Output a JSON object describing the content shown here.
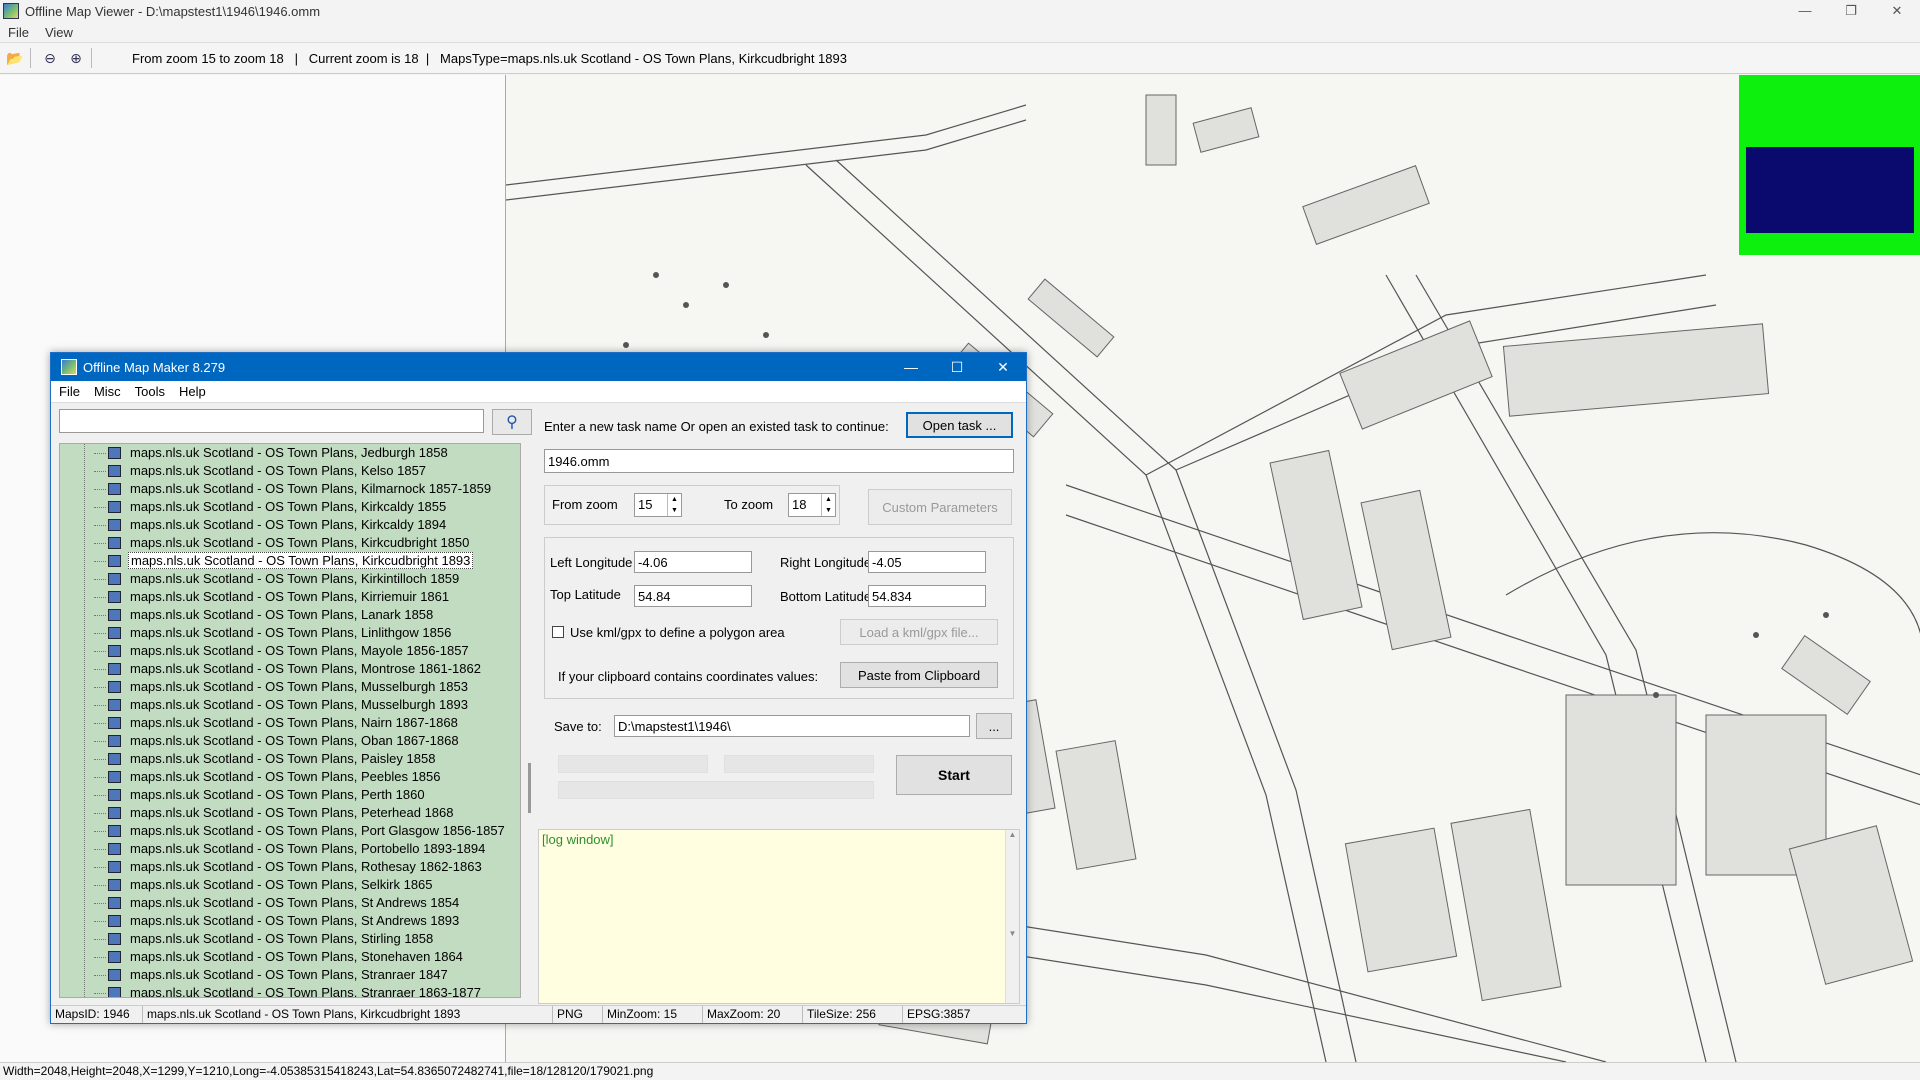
{
  "viewer": {
    "title": "Offline Map Viewer - D:\\mapstest1\\1946\\1946.omm",
    "menu": [
      "File",
      "View"
    ],
    "toolbar_info": "From zoom 15 to zoom 18   |   Current zoom is 18  |   MapsType=maps.nls.uk Scotland - OS Town Plans, Kirkcudbright 1893",
    "status": "Width=2048,Height=2048,X=1299,Y=1210,Long=-4.05385315418243,Lat=54.8365072482741,file=18/128120/179021.png",
    "icons": [
      "folder-open-icon",
      "zoom-out-icon",
      "zoom-in-icon"
    ]
  },
  "omm": {
    "title": "Offline Map Maker 8.279",
    "menu": [
      "File",
      "Misc",
      "Tools",
      "Help"
    ],
    "search_value": "",
    "tree_items": [
      "maps.nls.uk Scotland - OS Town Plans, Jedburgh 1858",
      "maps.nls.uk Scotland - OS Town Plans, Kelso 1857",
      "maps.nls.uk Scotland - OS Town Plans, Kilmarnock 1857-1859",
      "maps.nls.uk Scotland - OS Town Plans, Kirkcaldy 1855",
      "maps.nls.uk Scotland - OS Town Plans, Kirkcaldy 1894",
      "maps.nls.uk Scotland - OS Town Plans, Kirkcudbright 1850",
      "maps.nls.uk Scotland - OS Town Plans, Kirkcudbright 1893",
      "maps.nls.uk Scotland - OS Town Plans, Kirkintilloch 1859",
      "maps.nls.uk Scotland - OS Town Plans, Kirriemuir 1861",
      "maps.nls.uk Scotland - OS Town Plans, Lanark 1858",
      "maps.nls.uk Scotland - OS Town Plans, Linlithgow 1856",
      "maps.nls.uk Scotland - OS Town Plans, Mayole 1856-1857",
      "maps.nls.uk Scotland - OS Town Plans, Montrose 1861-1862",
      "maps.nls.uk Scotland - OS Town Plans, Musselburgh 1853",
      "maps.nls.uk Scotland - OS Town Plans, Musselburgh 1893",
      "maps.nls.uk Scotland - OS Town Plans, Nairn 1867-1868",
      "maps.nls.uk Scotland - OS Town Plans, Oban 1867-1868",
      "maps.nls.uk Scotland - OS Town Plans, Paisley 1858",
      "maps.nls.uk Scotland - OS Town Plans, Peebles 1856",
      "maps.nls.uk Scotland - OS Town Plans, Perth 1860",
      "maps.nls.uk Scotland - OS Town Plans, Peterhead 1868",
      "maps.nls.uk Scotland - OS Town Plans, Port Glasgow 1856-1857",
      "maps.nls.uk Scotland - OS Town Plans, Portobello 1893-1894",
      "maps.nls.uk Scotland - OS Town Plans, Rothesay 1862-1863",
      "maps.nls.uk Scotland - OS Town Plans, Selkirk 1865",
      "maps.nls.uk Scotland - OS Town Plans, St Andrews 1854",
      "maps.nls.uk Scotland - OS Town Plans, St Andrews 1893",
      "maps.nls.uk Scotland - OS Town Plans, Stirling 1858",
      "maps.nls.uk Scotland - OS Town Plans, Stonehaven 1864",
      "maps.nls.uk Scotland - OS Town Plans, Stranraer 1847",
      "maps.nls.uk Scotland - OS Town Plans, Stranraer 1863-1877"
    ],
    "selected_index": 6,
    "task_prompt": "Enter a new task name Or open an existed task to continue:",
    "open_task_label": "Open task ...",
    "task_name": "1946.omm",
    "from_zoom_label": "From zoom",
    "from_zoom": "15",
    "to_zoom_label": "To zoom",
    "to_zoom": "18",
    "custom_params_label": "Custom Parameters",
    "left_lon_label": "Left Longitude",
    "left_lon": "-4.06",
    "right_lon_label": "Right Longitude",
    "right_lon": "-4.05",
    "top_lat_label": "Top Latitude",
    "top_lat": "54.84",
    "bottom_lat_label": "Bottom Latitude",
    "bottom_lat": "54.834",
    "kml_label": "Use kml/gpx to define a polygon area",
    "load_kml_label": "Load a kml/gpx file...",
    "clipboard_prompt": "If your clipboard contains coordinates values:",
    "paste_label": "Paste from Clipboard",
    "save_to_label": "Save to:",
    "save_path": "D:\\mapstest1\\1946\\",
    "browse_label": "...",
    "start_label": "Start",
    "log_text": "[log window]",
    "status": {
      "maps_id": "MapsID: 1946",
      "maps_name": "maps.nls.uk Scotland - OS Town Plans, Kirkcudbright 1893",
      "format": "PNG",
      "min_zoom": "MinZoom: 15",
      "max_zoom": "MaxZoom: 20",
      "tile_size": "TileSize: 256",
      "epsg": "EPSG:3857"
    }
  },
  "colors": {
    "titlebar_blue": "#0067c0",
    "tree_green": "#c2dcc2",
    "log_bg": "#fffee0",
    "overlay_green": "#0df00d",
    "overlay_navy": "#0a0a6e"
  }
}
